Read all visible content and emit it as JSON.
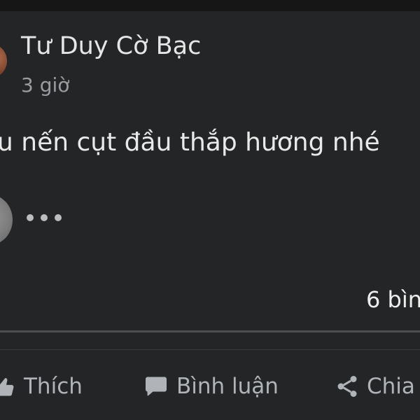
{
  "post": {
    "author": "Tư Duy Cờ Bạc",
    "time": "3 giờ",
    "text": "u nến cụt đầu thắp hương nhé",
    "comment_count_visible": "6 bìn"
  },
  "actions": {
    "like_label": "Thích",
    "comment_label": "Bình luận",
    "share_label": "Chia"
  },
  "icons": {
    "like": "thumbs-up-icon",
    "comment": "speech-bubble-icon",
    "share": "share-icon",
    "typing": "typing-indicator-dots"
  },
  "colors": {
    "background": "#242526",
    "primary_text": "#e9e9e9",
    "secondary_text": "#9a9ca0",
    "action_text": "#b0b3b8"
  }
}
